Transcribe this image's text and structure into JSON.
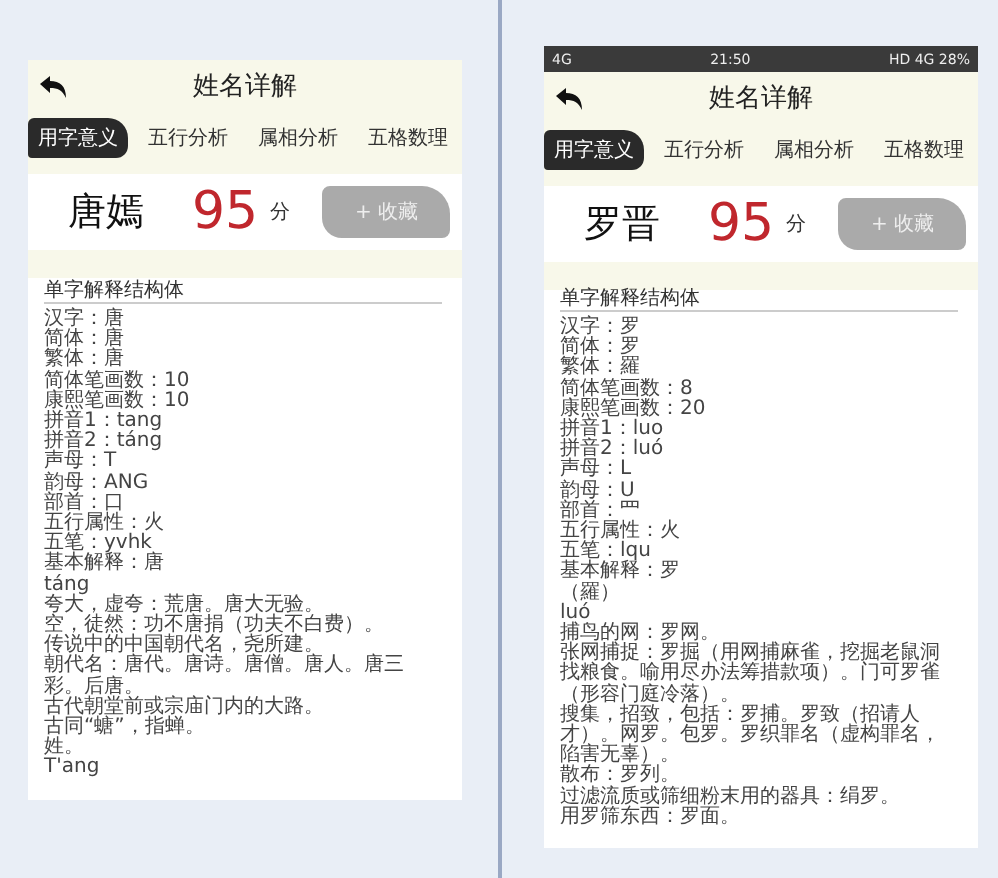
{
  "phones": [
    {
      "title": "姓名详解",
      "tabs": [
        {
          "label": "用字意义",
          "selected": true
        },
        {
          "label": "五行分析",
          "selected": false
        },
        {
          "label": "属相分析",
          "selected": false
        },
        {
          "label": "五格数理",
          "selected": false
        }
      ],
      "name": "唐嫣",
      "score": "95",
      "score_unit": "分",
      "favorite_button": "+ 收藏",
      "section_title": "单字解释结构体",
      "lines": [
        "汉字：唐",
        "简体：唐",
        "繁体：唐",
        "简体笔画数：10",
        "康熙笔画数：10",
        "拼音1：tang",
        "拼音2：táng",
        "声母：T",
        "韵母：ANG",
        "部首：口",
        "五行属性：火",
        "五笔：yvhk",
        "基本解释：唐",
        "táng",
        "夸大，虚夸：荒唐。唐大无验。",
        "空，徒然：功不唐捐（功夫不白费）。",
        "传说中的中国朝代名，尧所建。",
        "朝代名：唐代。唐诗。唐僧。唐人。唐三彩。后唐。",
        "古代朝堂前或宗庙门内的大路。",
        "古同“螗”，指蝉。",
        "姓。",
        "T'ang"
      ]
    },
    {
      "status_bar": {
        "network": "4G",
        "time": "21:50",
        "indicators": "HD 4G 28%"
      },
      "title": "姓名详解",
      "tabs": [
        {
          "label": "用字意义",
          "selected": true
        },
        {
          "label": "五行分析",
          "selected": false
        },
        {
          "label": "属相分析",
          "selected": false
        },
        {
          "label": "五格数理",
          "selected": false
        }
      ],
      "name": "罗晋",
      "score": "95",
      "score_unit": "分",
      "favorite_button": "+ 收藏",
      "section_title": "单字解释结构体",
      "lines": [
        "汉字：罗",
        "简体：罗",
        "繁体：羅",
        "简体笔画数：8",
        "康熙笔画数：20",
        "拼音1：luo",
        "拼音2：luó",
        "声母：L",
        "韵母：U",
        "部首：罒",
        "五行属性：火",
        "五笔：lqu",
        "基本解释：罗",
        "（羅）",
        "luó",
        "捕鸟的网：罗网。",
        "张网捕捉：罗掘（用网捕麻雀，挖掘老鼠洞找粮食。喻用尽办法筹措款项）。门可罗雀（形容门庭冷落）。",
        "搜集，招致，包括：罗捕。罗致（招请人才）。网罗。包罗。罗织罪名（虚构罪名，陷害无辜）。",
        "散布：罗列。",
        "过滤流质或筛细粉末用的器具：绢罗。",
        "用罗筛东西：罗面。"
      ]
    }
  ]
}
